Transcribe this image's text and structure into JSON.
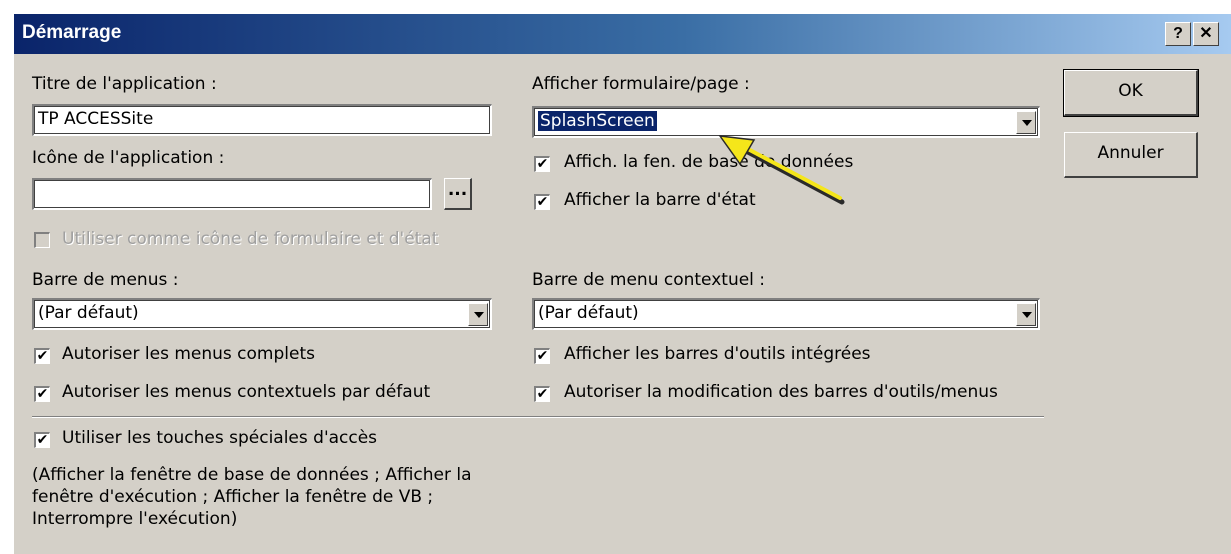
{
  "window": {
    "title": "Démarrage",
    "help_label": "?",
    "close_label": "✕"
  },
  "left": {
    "app_title_label": "Titre de l'application :",
    "app_title_value": "TP ACCESSite",
    "app_icon_label": "Icône de l'application :",
    "app_icon_value": "",
    "browse_label": "...",
    "use_icon_label": "Utiliser comme icône de formulaire et d'état",
    "menu_bar_label": "Barre de menus :",
    "menu_bar_value": "(Par défaut)",
    "full_menus_label": "Autoriser les menus complets",
    "default_shortcut_menus_label": "Autoriser les menus contextuels par défaut",
    "special_keys_label": "Utiliser les touches spéciales d'accès",
    "special_keys_note": "(Afficher la fenêtre de base de données ; Afficher la fenêtre d'exécution ; Afficher la fenêtre de VB ; Interrompre l'exécution)"
  },
  "right": {
    "display_form_label": "Afficher formulaire/page :",
    "display_form_value": "SplashScreen",
    "show_db_window_label": "Affich. la fen. de base de données",
    "show_status_bar_label": "Afficher la barre d'état",
    "shortcut_menu_bar_label": "Barre de menu contextuel :",
    "shortcut_menu_bar_value": "(Par défaut)",
    "builtin_toolbars_label": "Afficher les barres d'outils intégrées",
    "toolbar_changes_label": "Autoriser la modification des barres d'outils/menus"
  },
  "buttons": {
    "ok": "OK",
    "cancel": "Annuler"
  },
  "checkbox_mark": "✔",
  "colors": {
    "dialog_bg": "#d4d0c8",
    "title_start": "#0a246a",
    "selection": "#0a246a",
    "arrow": "#f5e61a"
  }
}
